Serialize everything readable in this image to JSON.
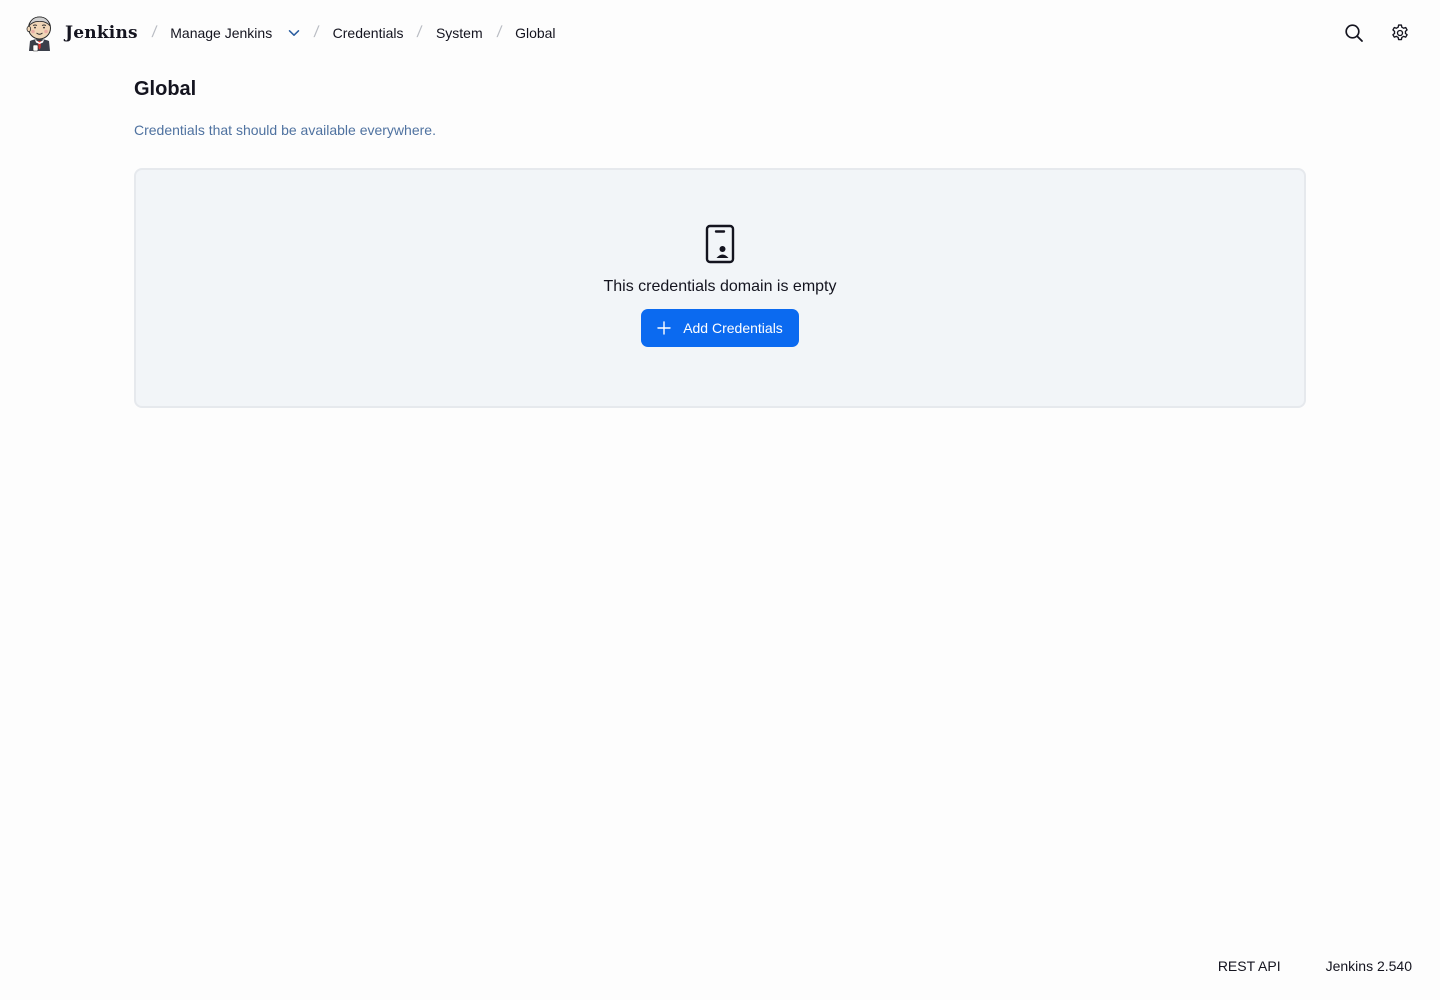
{
  "header": {
    "logo_text": "Jenkins",
    "breadcrumbs": [
      {
        "label": "Manage Jenkins"
      },
      {
        "label": "Credentials"
      },
      {
        "label": "System"
      },
      {
        "label": "Global"
      }
    ],
    "icons": {
      "dropdown": "chevron-down-icon",
      "search": "search-icon",
      "settings": "gear-icon"
    }
  },
  "page": {
    "title": "Global",
    "description": "Credentials that should be available everywhere."
  },
  "empty_state": {
    "icon": "id-badge-icon",
    "message": "This credentials domain is empty",
    "button_label": "Add Credentials",
    "button_icon": "plus-icon"
  },
  "footer": {
    "rest_api": "REST API",
    "version": "Jenkins 2.540"
  },
  "colors": {
    "accent": "#0b6af0",
    "description_text": "#4f72a0",
    "panel_background": "#f2f5f8"
  }
}
